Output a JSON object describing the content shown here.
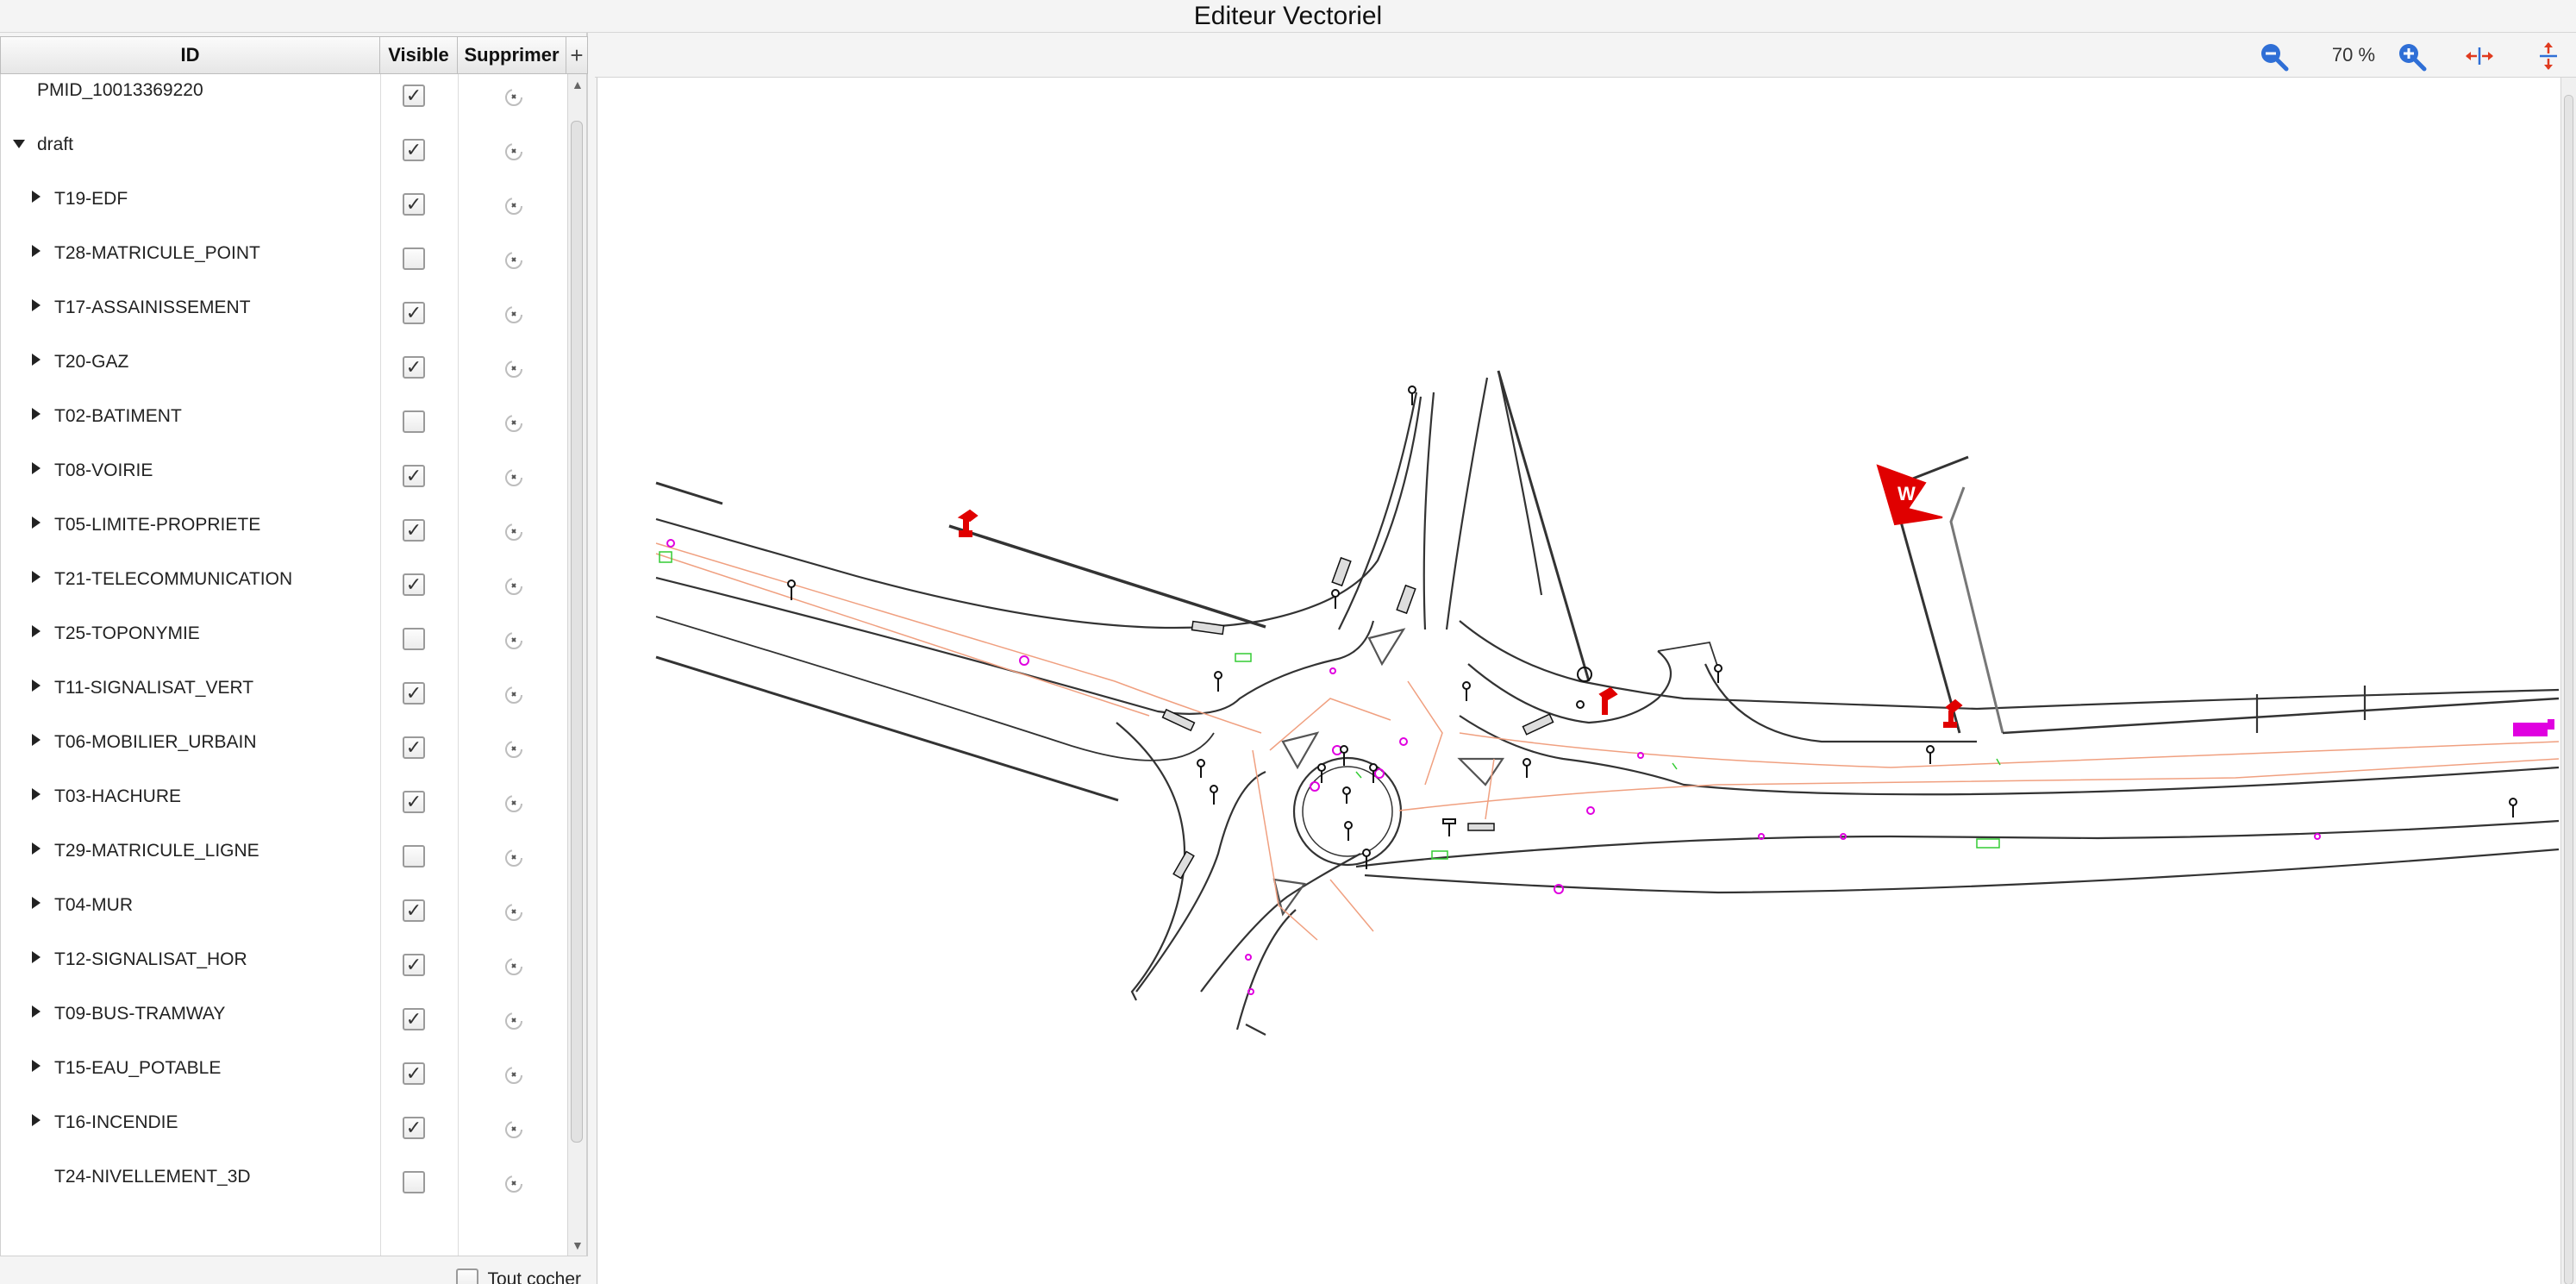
{
  "window": {
    "title": "Editeur Vectoriel"
  },
  "layer_table": {
    "headers": {
      "id": "ID",
      "visible": "Visible",
      "delete": "Supprimer",
      "add": "+"
    },
    "rows": [
      {
        "id": "PMID_10013369220",
        "level": 0,
        "expander": "none",
        "visible": true
      },
      {
        "id": "draft",
        "level": 0,
        "expander": "expanded",
        "visible": true
      },
      {
        "id": "T19-EDF",
        "level": 1,
        "expander": "collapsed",
        "visible": true
      },
      {
        "id": "T28-MATRICULE_POINT",
        "level": 1,
        "expander": "collapsed",
        "visible": false
      },
      {
        "id": "T17-ASSAINISSEMENT",
        "level": 1,
        "expander": "collapsed",
        "visible": true
      },
      {
        "id": "T20-GAZ",
        "level": 1,
        "expander": "collapsed",
        "visible": true
      },
      {
        "id": "T02-BATIMENT",
        "level": 1,
        "expander": "collapsed",
        "visible": false
      },
      {
        "id": "T08-VOIRIE",
        "level": 1,
        "expander": "collapsed",
        "visible": true
      },
      {
        "id": "T05-LIMITE-PROPRIETE",
        "level": 1,
        "expander": "collapsed",
        "visible": true
      },
      {
        "id": "T21-TELECOMMUNICATION",
        "level": 1,
        "expander": "collapsed",
        "visible": true
      },
      {
        "id": "T25-TOPONYMIE",
        "level": 1,
        "expander": "collapsed",
        "visible": false
      },
      {
        "id": "T11-SIGNALISAT_VERT",
        "level": 1,
        "expander": "collapsed",
        "visible": true
      },
      {
        "id": "T06-MOBILIER_URBAIN",
        "level": 1,
        "expander": "collapsed",
        "visible": true
      },
      {
        "id": "T03-HACHURE",
        "level": 1,
        "expander": "collapsed",
        "visible": true
      },
      {
        "id": "T29-MATRICULE_LIGNE",
        "level": 1,
        "expander": "collapsed",
        "visible": false
      },
      {
        "id": "T04-MUR",
        "level": 1,
        "expander": "collapsed",
        "visible": true
      },
      {
        "id": "T12-SIGNALISAT_HOR",
        "level": 1,
        "expander": "collapsed",
        "visible": true
      },
      {
        "id": "T09-BUS-TRAMWAY",
        "level": 1,
        "expander": "collapsed",
        "visible": true
      },
      {
        "id": "T15-EAU_POTABLE",
        "level": 1,
        "expander": "collapsed",
        "visible": true
      },
      {
        "id": "T16-INCENDIE",
        "level": 1,
        "expander": "collapsed",
        "visible": true
      },
      {
        "id": "T24-NIVELLEMENT_3D",
        "level": 1,
        "expander": "none",
        "visible": false
      }
    ]
  },
  "footer": {
    "check_all_label": "Tout cocher",
    "check_all_value": false
  },
  "toolbar": {
    "zoom_out_icon": "zoom-out-icon",
    "zoom_level": "70 %",
    "zoom_in_icon": "zoom-in-icon",
    "fit_width_icon": "fit-width-icon",
    "fit_height_icon": "fit-height-icon"
  },
  "colors": {
    "accent_blue": "#2f6fd6",
    "fit_arrow_red": "#e03a1e",
    "road_lines": "#333333",
    "property_lines": "#f0a080",
    "magenta_markers": "#e000e0",
    "red_signs": "#e00000",
    "green_markers": "#33cc33"
  }
}
